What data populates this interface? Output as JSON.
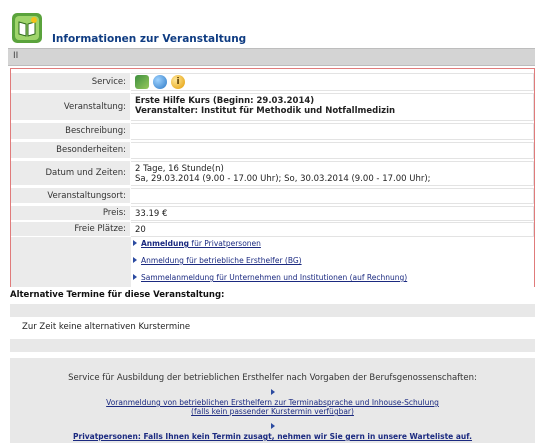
{
  "header": {
    "title": "Informationen zur Veranstaltung",
    "logo_icon": "book-icon"
  },
  "toolbar": {
    "label": "II"
  },
  "details": {
    "service_label": "Service:",
    "veranstaltung_label": "Veranstaltung:",
    "veranstaltung_line1": "Erste Hilfe Kurs (Beginn: 29.03.2014)",
    "veranstaltung_line2": "Veranstalter: Institut für Methodik und Notfallmedizin",
    "beschreibung_label": "Beschreibung:",
    "besonderheiten_label": "Besonderheiten:",
    "datum_label": "Datum und Zeiten:",
    "datum_line1": "2 Tage, 16 Stunde(n)",
    "datum_line2": "Sa, 29.03.2014 (9.00 - 17.00 Uhr); So, 30.03.2014 (9.00 - 17.00 Uhr);",
    "ort_label": "Veranstaltungsort:",
    "preis_label": "Preis:",
    "preis_value": "33.19 €",
    "plaetze_label": "Freie Plätze:",
    "plaetze_value": "20",
    "info_glyph": "i"
  },
  "links": {
    "privat_bold": "Anmeldung",
    "privat_rest": " für Privatpersonen",
    "betrieblich": "Anmeldung für betriebliche Ersthelfer (BG)",
    "sammel": "Sammelanmeldung für Unternehmen und Institutionen (auf Rechnung)"
  },
  "alternatives": {
    "title": "Alternative Termine für diese Veranstaltung:",
    "note": "Zur Zeit keine alternativen Kurstermine"
  },
  "service": {
    "text": "Service für Ausbildung der betrieblichen Ersthelfer nach Vorgaben der Berufsgenossenschaften:",
    "voranmeldung_line1": "Voranmeldung von betrieblichen Ersthelfern zur Terminabsprache und Inhouse-Schulung",
    "voranmeldung_line2": "(falls kein passender Kurstermin verfügbar)",
    "warteliste": "Privatpersonen: Falls Ihnen kein Termin zusagt, nehmen wir Sie gern in unsere Warteliste auf."
  }
}
